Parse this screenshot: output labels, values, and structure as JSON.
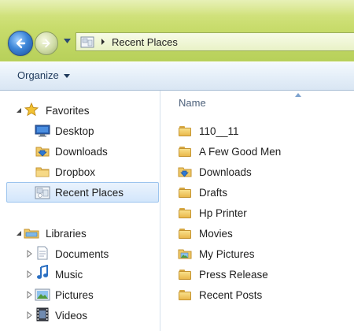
{
  "address_bar": {
    "location": "Recent Places"
  },
  "toolbar": {
    "organize_label": "Organize"
  },
  "navigation": {
    "favorites": {
      "label": "Favorites",
      "items": [
        {
          "label": "Desktop",
          "icon": "desktop-icon"
        },
        {
          "label": "Downloads",
          "icon": "downloads-folder-icon"
        },
        {
          "label": "Dropbox",
          "icon": "folder-icon"
        },
        {
          "label": "Recent Places",
          "icon": "recent-places-icon",
          "selected": true
        }
      ]
    },
    "libraries": {
      "label": "Libraries",
      "items": [
        {
          "label": "Documents",
          "icon": "documents-library-icon"
        },
        {
          "label": "Music",
          "icon": "music-library-icon"
        },
        {
          "label": "Pictures",
          "icon": "pictures-library-icon"
        },
        {
          "label": "Videos",
          "icon": "videos-library-icon"
        }
      ]
    }
  },
  "file_list": {
    "column_header": "Name",
    "items": [
      {
        "name": "110__11",
        "icon": "folder-icon"
      },
      {
        "name": "A Few Good Men",
        "icon": "folder-icon"
      },
      {
        "name": "Downloads",
        "icon": "downloads-folder-icon"
      },
      {
        "name": "Drafts",
        "icon": "folder-icon"
      },
      {
        "name": "Hp Printer",
        "icon": "folder-icon"
      },
      {
        "name": "Movies",
        "icon": "folder-icon"
      },
      {
        "name": "My Pictures",
        "icon": "pictures-folder-icon"
      },
      {
        "name": "Press Release",
        "icon": "folder-icon"
      },
      {
        "name": "Recent Posts",
        "icon": "folder-icon"
      }
    ]
  },
  "colors": {
    "chrome": "#c8dc6c",
    "toolbar": "#e4eef8",
    "selection": "#d3e6fb",
    "link_text": "#1e395b"
  }
}
